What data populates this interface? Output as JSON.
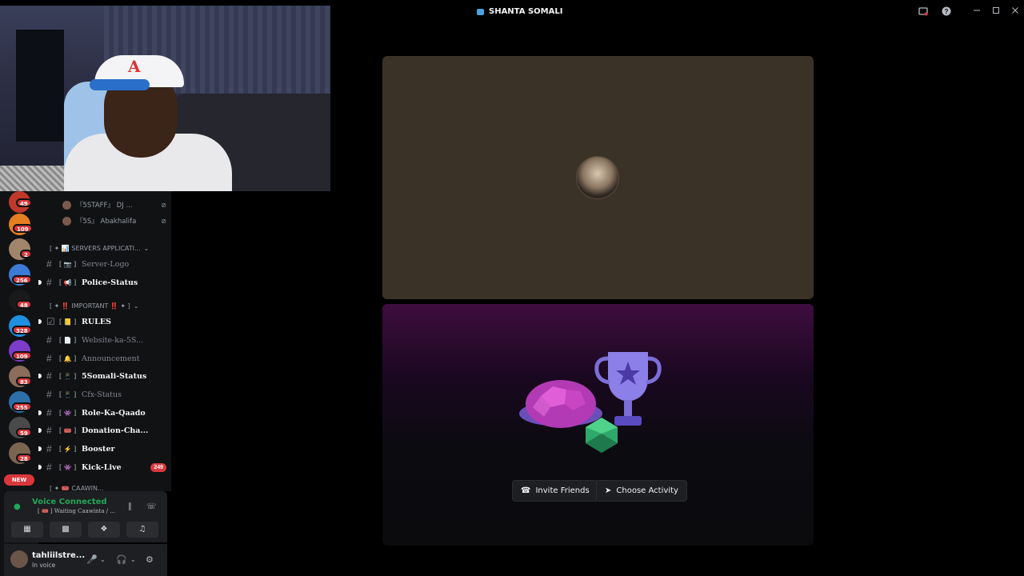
{
  "titlebar": {
    "title": "SHANTA SOMALI",
    "icons": [
      "inbox-icon",
      "help-icon",
      "minimize-icon",
      "maximize-icon",
      "close-icon"
    ]
  },
  "servers": [
    {
      "badge": "49",
      "color": "#c0392b"
    },
    {
      "badge": "109",
      "color": "#e67e22"
    },
    {
      "badge": "2",
      "color": "#a0856a"
    },
    {
      "badge": "256",
      "color": "#3c7bd6"
    },
    {
      "badge": "48",
      "color": "#1a1a1a"
    },
    {
      "badge": "328",
      "color": "#1f8fe0"
    },
    {
      "badge": "109",
      "color": "#7d3cc9"
    },
    {
      "badge": "83",
      "color": "#8a6d5a"
    },
    {
      "badge": "255",
      "color": "#2d6fa8"
    },
    {
      "badge": "59",
      "color": "#4a4a4a"
    },
    {
      "badge": "28",
      "color": "#7a6550"
    }
  ],
  "new_badge": "NEW",
  "members": [
    {
      "name": "『5STAFF』 DJ ..."
    },
    {
      "name": "『5S』 Abakhalifa"
    }
  ],
  "categories": [
    {
      "label": "[ ✦ 📊 SERVERS APPLICATI..."
    },
    {
      "label": "[ ✦ ‼️ IMPORTANT ‼️ ✦ ]"
    },
    {
      "label": "[ ✦ 🎟️ CAAWIN..."
    }
  ],
  "channels": [
    {
      "emoji": "[ 📷 ]",
      "name": "Server-Logo",
      "unread": false,
      "count": ""
    },
    {
      "emoji": "[ 📢 ]",
      "name": "Police-Status",
      "unread": true,
      "count": ""
    },
    {
      "emoji": "[ 📒 ]",
      "name": "RULES",
      "unread": true,
      "count": ""
    },
    {
      "emoji": "[ 📄 ]",
      "name": "Website-ka-5S...",
      "unread": false,
      "count": ""
    },
    {
      "emoji": "[ 🔔 ]",
      "name": "Announcement",
      "unread": false,
      "count": ""
    },
    {
      "emoji": "[ 📱 ]",
      "name": "5Somali-Status",
      "unread": true,
      "count": ""
    },
    {
      "emoji": "[ 📱 ]",
      "name": "Cfx-Status",
      "unread": false,
      "count": ""
    },
    {
      "emoji": "[ 👾 ]",
      "name": "Role-Ka-Qaado",
      "unread": true,
      "count": ""
    },
    {
      "emoji": "[ 🎟️ ]",
      "name": "Donation-Cha...",
      "unread": true,
      "count": ""
    },
    {
      "emoji": "[ ⚡ ]",
      "name": "Booster",
      "unread": true,
      "count": ""
    },
    {
      "emoji": "[ 👾 ]",
      "name": "Kick-Live",
      "unread": true,
      "count": "249"
    }
  ],
  "voice": {
    "status": "Voice Connected",
    "channel": "[ 🎟️ ] Waiting Caawinta / ..."
  },
  "user": {
    "name": "tahliilstre...",
    "status": "In voice"
  },
  "stage": {
    "buttons": {
      "invite": "Invite Friends",
      "activity": "Choose Activity"
    }
  }
}
